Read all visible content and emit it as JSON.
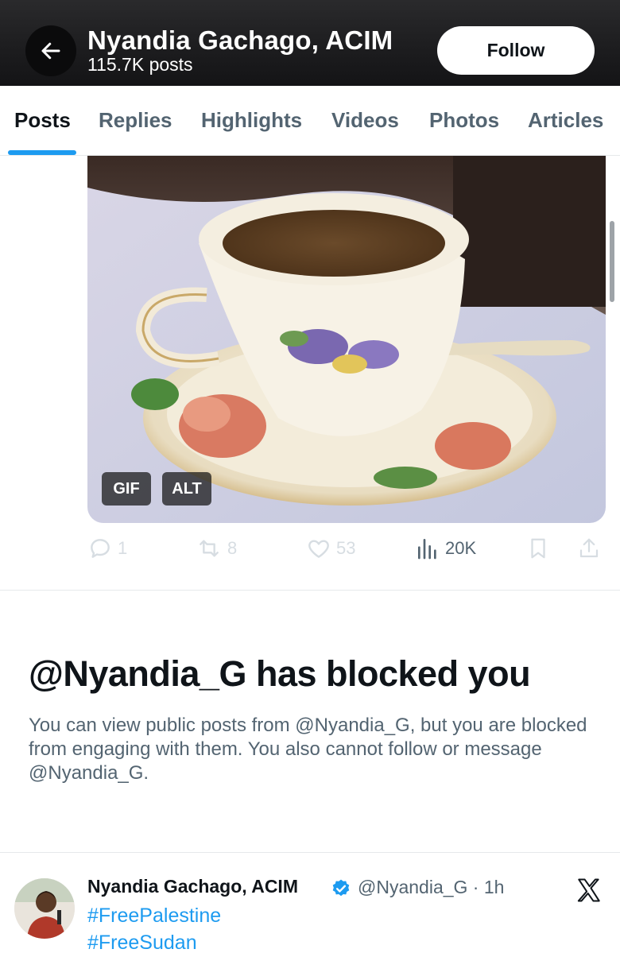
{
  "header": {
    "name": "Nyandia Gachago, ACIM",
    "post_count": "115.7K posts",
    "follow_label": "Follow"
  },
  "tabs": [
    {
      "label": "Posts",
      "active": true
    },
    {
      "label": "Replies"
    },
    {
      "label": "Highlights"
    },
    {
      "label": "Videos"
    },
    {
      "label": "Photos"
    },
    {
      "label": "Articles"
    }
  ],
  "media": {
    "gif_badge": "GIF",
    "alt_badge": "ALT"
  },
  "actions": {
    "replies": "1",
    "reposts": "8",
    "likes": "53",
    "views": "20K"
  },
  "blocked": {
    "title": "@Nyandia_G has blocked you",
    "body": "You can view public posts from @Nyandia_G, but you are blocked from engaging with them. You also cannot follow or message @Nyandia_G."
  },
  "post": {
    "author_name": "Nyandia Gachago, ACIM",
    "handle_time": "@Nyandia_G · 1h",
    "hashtags": [
      "#FreePalestine",
      "#FreeSudan"
    ]
  },
  "colors": {
    "accent": "#1d9bf0",
    "muted_text": "#536471",
    "primary_text": "#0f1419"
  },
  "icons": {
    "back": "arrow-left-icon",
    "reply": "reply-icon",
    "repost": "repost-icon",
    "like": "heart-icon",
    "views": "views-icon",
    "bookmark": "bookmark-icon",
    "share": "share-icon",
    "verified": "verified-badge-icon",
    "brand": "x-logo-icon"
  }
}
